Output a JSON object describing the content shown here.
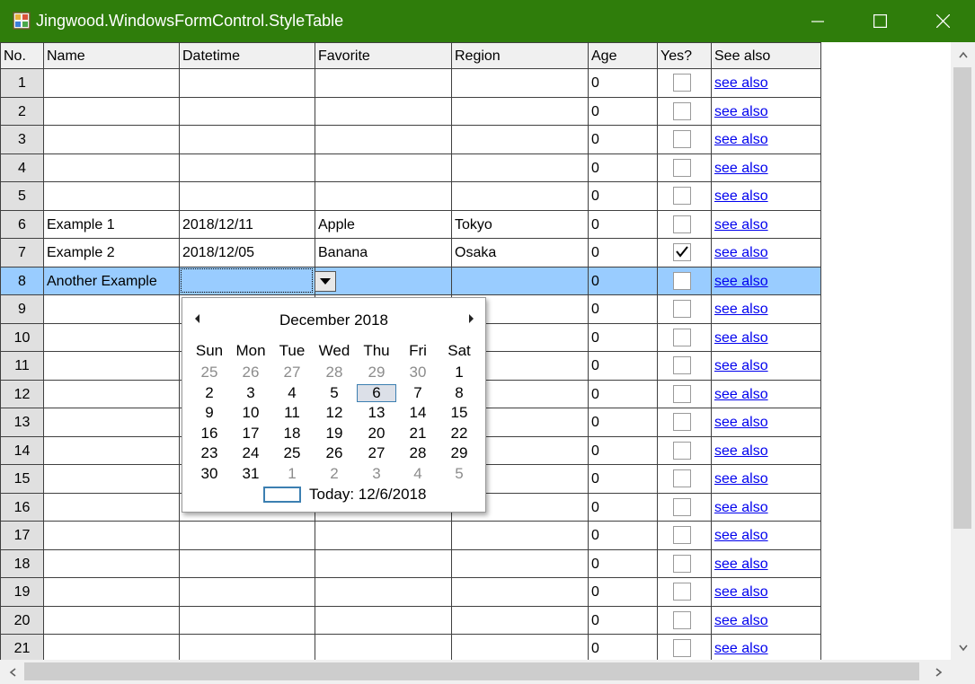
{
  "window": {
    "title": "Jingwood.WindowsFormControl.StyleTable",
    "minimize_icon": "minimize-icon",
    "maximize_icon": "maximize-icon",
    "close_icon": "close-icon",
    "titlebar_color": "#2f7d0b"
  },
  "table": {
    "columns": [
      "No.",
      "Name",
      "Datetime",
      "Favorite",
      "Region",
      "Age",
      "Yes?",
      "See also"
    ],
    "rows": [
      {
        "no": "1",
        "name": "",
        "datetime": "",
        "favorite": "",
        "region": "",
        "age": "0",
        "yes": false,
        "see_also": "see also"
      },
      {
        "no": "2",
        "name": "",
        "datetime": "",
        "favorite": "",
        "region": "",
        "age": "0",
        "yes": false,
        "see_also": "see also"
      },
      {
        "no": "3",
        "name": "",
        "datetime": "",
        "favorite": "",
        "region": "",
        "age": "0",
        "yes": false,
        "see_also": "see also"
      },
      {
        "no": "4",
        "name": "",
        "datetime": "",
        "favorite": "",
        "region": "",
        "age": "0",
        "yes": false,
        "see_also": "see also"
      },
      {
        "no": "5",
        "name": "",
        "datetime": "",
        "favorite": "",
        "region": "",
        "age": "0",
        "yes": false,
        "see_also": "see also"
      },
      {
        "no": "6",
        "name": "Example 1",
        "datetime": "2018/12/11",
        "favorite": "Apple",
        "region": "Tokyo",
        "age": "0",
        "yes": false,
        "see_also": "see also"
      },
      {
        "no": "7",
        "name": "Example 2",
        "datetime": "2018/12/05",
        "favorite": "Banana",
        "region": "Osaka",
        "age": "0",
        "yes": true,
        "see_also": "see also"
      },
      {
        "no": "8",
        "name": "Another Example",
        "datetime": "",
        "favorite": "",
        "region": "",
        "age": "0",
        "yes": false,
        "see_also": "see also",
        "selected": true
      },
      {
        "no": "9",
        "name": "",
        "datetime": "",
        "favorite": "",
        "region": "",
        "age": "0",
        "yes": false,
        "see_also": "see also"
      },
      {
        "no": "10",
        "name": "",
        "datetime": "",
        "favorite": "",
        "region": "",
        "age": "0",
        "yes": false,
        "see_also": "see also"
      },
      {
        "no": "11",
        "name": "",
        "datetime": "",
        "favorite": "",
        "region": "",
        "age": "0",
        "yes": false,
        "see_also": "see also"
      },
      {
        "no": "12",
        "name": "",
        "datetime": "",
        "favorite": "",
        "region": "",
        "age": "0",
        "yes": false,
        "see_also": "see also"
      },
      {
        "no": "13",
        "name": "",
        "datetime": "",
        "favorite": "",
        "region": "",
        "age": "0",
        "yes": false,
        "see_also": "see also"
      },
      {
        "no": "14",
        "name": "",
        "datetime": "",
        "favorite": "",
        "region": "",
        "age": "0",
        "yes": false,
        "see_also": "see also"
      },
      {
        "no": "15",
        "name": "",
        "datetime": "",
        "favorite": "",
        "region": "",
        "age": "0",
        "yes": false,
        "see_also": "see also"
      },
      {
        "no": "16",
        "name": "",
        "datetime": "",
        "favorite": "",
        "region": "",
        "age": "0",
        "yes": false,
        "see_also": "see also"
      },
      {
        "no": "17",
        "name": "",
        "datetime": "",
        "favorite": "",
        "region": "",
        "age": "0",
        "yes": false,
        "see_also": "see also"
      },
      {
        "no": "18",
        "name": "",
        "datetime": "",
        "favorite": "",
        "region": "",
        "age": "0",
        "yes": false,
        "see_also": "see also"
      },
      {
        "no": "19",
        "name": "",
        "datetime": "",
        "favorite": "",
        "region": "",
        "age": "0",
        "yes": false,
        "see_also": "see also"
      },
      {
        "no": "20",
        "name": "",
        "datetime": "",
        "favorite": "",
        "region": "",
        "age": "0",
        "yes": false,
        "see_also": "see also"
      },
      {
        "no": "21",
        "name": "",
        "datetime": "",
        "favorite": "",
        "region": "",
        "age": "0",
        "yes": false,
        "see_also": "see also"
      }
    ],
    "selection_color": "#99ccff",
    "link_color": "#0000ee"
  },
  "calendar": {
    "month_title": "December 2018",
    "prev_icon": "left-arrow-icon",
    "next_icon": "right-arrow-icon",
    "weekdays": [
      "Sun",
      "Mon",
      "Tue",
      "Wed",
      "Thu",
      "Fri",
      "Sat"
    ],
    "weeks": [
      [
        {
          "d": "25",
          "other": true
        },
        {
          "d": "26",
          "other": true
        },
        {
          "d": "27",
          "other": true
        },
        {
          "d": "28",
          "other": true
        },
        {
          "d": "29",
          "other": true
        },
        {
          "d": "30",
          "other": true
        },
        {
          "d": "1"
        }
      ],
      [
        {
          "d": "2"
        },
        {
          "d": "3"
        },
        {
          "d": "4"
        },
        {
          "d": "5"
        },
        {
          "d": "6",
          "today": true
        },
        {
          "d": "7"
        },
        {
          "d": "8"
        }
      ],
      [
        {
          "d": "9"
        },
        {
          "d": "10"
        },
        {
          "d": "11"
        },
        {
          "d": "12"
        },
        {
          "d": "13"
        },
        {
          "d": "14"
        },
        {
          "d": "15"
        }
      ],
      [
        {
          "d": "16"
        },
        {
          "d": "17"
        },
        {
          "d": "18"
        },
        {
          "d": "19"
        },
        {
          "d": "20"
        },
        {
          "d": "21"
        },
        {
          "d": "22"
        }
      ],
      [
        {
          "d": "23"
        },
        {
          "d": "24"
        },
        {
          "d": "25"
        },
        {
          "d": "26"
        },
        {
          "d": "27"
        },
        {
          "d": "28"
        },
        {
          "d": "29"
        }
      ],
      [
        {
          "d": "30"
        },
        {
          "d": "31"
        },
        {
          "d": "1",
          "other": true
        },
        {
          "d": "2",
          "other": true
        },
        {
          "d": "3",
          "other": true
        },
        {
          "d": "4",
          "other": true
        },
        {
          "d": "5",
          "other": true
        }
      ]
    ],
    "today_label": "Today: 12/6/2018"
  },
  "scrollbars": {
    "up_icon": "chevron-up-icon",
    "down_icon": "chevron-down-icon",
    "left_icon": "chevron-left-icon",
    "right_icon": "chevron-right-icon"
  }
}
